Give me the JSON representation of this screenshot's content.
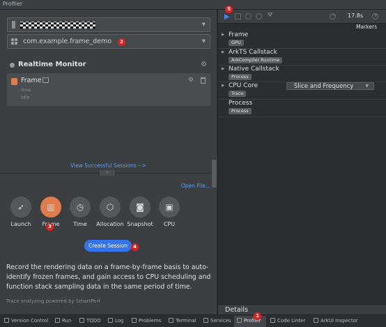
{
  "window": {
    "title": "Profiler"
  },
  "left": {
    "device_combo": {
      "value": ""
    },
    "app_combo": {
      "value": "com.example.frame_demo"
    },
    "monitor": {
      "title": "Realtime Monitor",
      "session": {
        "title": "Frame",
        "duration": "0ms",
        "state": "Idle"
      }
    },
    "view_sessions": "View Successful Sessions -->",
    "open_file": "Open File...",
    "tools": [
      {
        "label": "Launch",
        "icon": "rocket-icon"
      },
      {
        "label": "Frame",
        "icon": "frame-icon",
        "active": true
      },
      {
        "label": "Time",
        "icon": "clock-icon"
      },
      {
        "label": "Allocation",
        "icon": "cube-icon"
      },
      {
        "label": "Snapshot",
        "icon": "camera-icon"
      },
      {
        "label": "CPU",
        "icon": "chip-icon"
      }
    ],
    "create_session": "Create Session",
    "description": "Record the rendering data on a frame-by-frame basis to auto-identify frozen frames, and gain access to CPU scheduling and function stack sampling data in the same period of time.",
    "powered_by": "Trace analyzing powered by SmartPerf"
  },
  "right": {
    "timer": "17.8s",
    "markers_label": "Markers",
    "tracks": [
      {
        "name": "Frame",
        "chip": "GPU"
      },
      {
        "name": "ArkTS Callstack",
        "chip": "ArkCompiler Runtime"
      },
      {
        "name": "Native Callstack",
        "chip": "Process"
      },
      {
        "name": "CPU Core",
        "chip": "Trace",
        "dropdown": "Slice and Frequency"
      },
      {
        "name": "Process",
        "chip": "Process"
      }
    ],
    "details_label": "Details"
  },
  "annotations": [
    "1",
    "2",
    "3",
    "4",
    "5"
  ],
  "bottom_bar": {
    "items": [
      "Version Control",
      "Run",
      "TODO",
      "Log",
      "Problems",
      "Terminal",
      "Services",
      "Profiler",
      "Code Linter",
      "ArkUI Inspector"
    ]
  },
  "colors": {
    "accent": "#3574f0",
    "frame_active": "#e07b4b",
    "link": "#589df6",
    "badge": "#e02020"
  }
}
